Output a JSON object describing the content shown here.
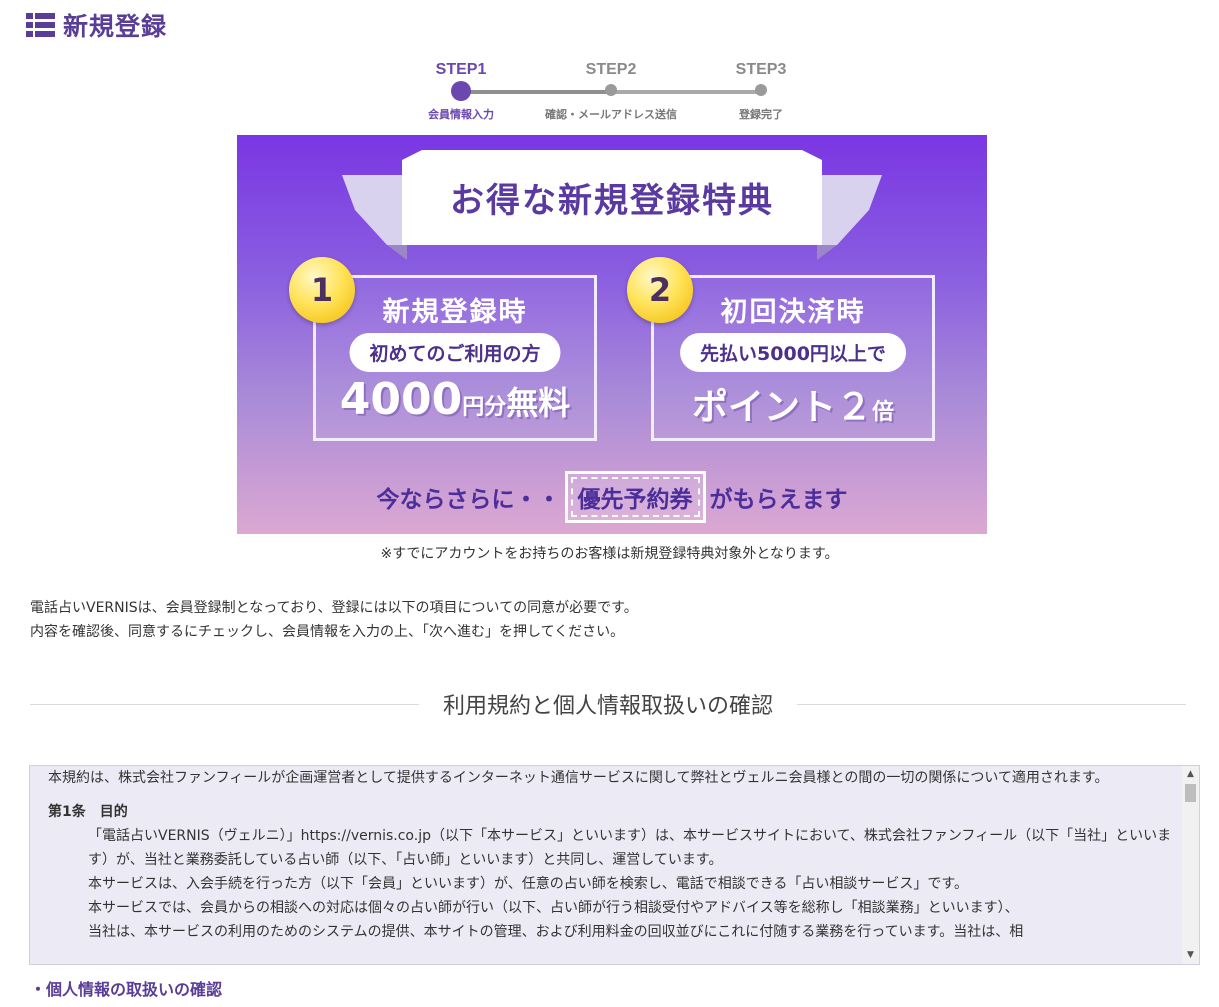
{
  "header": {
    "title": "新規登録",
    "icon": "list-icon"
  },
  "stepper": {
    "steps": [
      {
        "label": "STEP1",
        "sub": "会員情報入力",
        "active": true
      },
      {
        "label": "STEP2",
        "sub": "確認・メールアドレス送信",
        "active": false
      },
      {
        "label": "STEP3",
        "sub": "登録完了",
        "active": false
      }
    ]
  },
  "banner": {
    "title": "お得な新規登録特典",
    "benefit1": {
      "num": "1",
      "head": "新規登録時",
      "pill": "初めてのご利用の方",
      "big_main": "4000",
      "big_unit": "円分",
      "big_tail": "無料"
    },
    "benefit2": {
      "num": "2",
      "head": "初回決済時",
      "pill": "先払い5000円以上で",
      "big_main": "ポイント２",
      "big_unit": "倍"
    },
    "bottom_pre": "今ならさらに・・",
    "bottom_ticket": "優先予約券",
    "bottom_post": "がもらえます"
  },
  "banner_note": "※すでにアカウントをお持ちのお客様は新規登録特典対象外となります。",
  "intro": {
    "line1": "電話占いVERNISは、会員登録制となっており、登録には以下の項目についての同意が必要です。",
    "line2": "内容を確認後、同意するにチェックし、会員情報を入力の上、「次へ進む」を押してください。"
  },
  "section_heading": "利用規約と個人情報取扱いの確認",
  "terms": {
    "intro": "本規約は、株式会社ファンフィールが企画運営者として提供するインターネット通信サービスに関して弊社とヴェルニ会員様との間の一切の関係について適用されます。",
    "article1_title": "第1条　目的",
    "article1_p1": "「電話占いVERNIS（ヴェルニ）」https://vernis.co.jp（以下「本サービス」といいます）は、本サービスサイトにおいて、株式会社ファンフィール（以下「当社」といいます）が、当社と業務委託している占い師（以下、「占い師」といいます）と共同し、運営しています。",
    "article1_p2": "本サービスは、入会手続を行った方（以下「会員」といいます）が、任意の占い師を検索し、電話で相談できる「占い相談サービス」です。",
    "article1_p3": "本サービスでは、会員からの相談への対応は個々の占い師が行い（以下、占い師が行う相談受付やアドバイス等を総称し「相談業務」といいます）、",
    "article1_p4": "当社は、本サービスの利用のためのシステムの提供、本サイトの管理、および利用料金の回収並びにこれに付随する業務を行っています。当社は、相"
  },
  "privacy_link": "・個人情報の取扱いの確認",
  "colors": {
    "brand": "#5a3d96",
    "accent": "#6a48b0",
    "banner_top": "#7a36e3",
    "banner_bottom": "#dca8d2"
  }
}
